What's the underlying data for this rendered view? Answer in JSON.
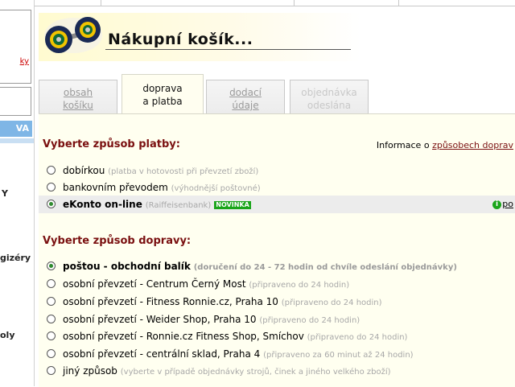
{
  "page_title": "Nákupní košík...",
  "left_nav": {
    "link_fragment": "ky",
    "va_label": "VA",
    "frag_1": "Y",
    "frag_2": "gizéry",
    "frag_3": "oly"
  },
  "tabs": [
    {
      "line1": "obsah",
      "line2": "košíku",
      "state": "link"
    },
    {
      "line1": "doprava",
      "line2": "a platba",
      "state": "active"
    },
    {
      "line1": "dodací",
      "line2": "údaje",
      "state": "link"
    },
    {
      "line1": "objednávka",
      "line2": "odeslána",
      "state": "disabled"
    }
  ],
  "payment": {
    "heading": "Vyberte způsob platby:",
    "info_prefix": "Informace o ",
    "info_link": "způsobech doprav",
    "options": [
      {
        "label": "dobírkou",
        "note": "(platba v hotovosti při převzetí zboží)",
        "selected": false
      },
      {
        "label": "bankovním převodem",
        "note": "(výhodnější poštovné)",
        "selected": false
      },
      {
        "label": "eKonto on-line",
        "note": "(Raiffeisenbank)",
        "badge": "NOVINKA",
        "selected": true,
        "info_icon": "i",
        "info_link": "po"
      }
    ]
  },
  "shipping": {
    "heading": "Vyberte způsob dopravy:",
    "options": [
      {
        "label": "poštou - obchodní balík",
        "note": "(doručení do 24 - 72 hodin od chvíle odeslání objednávky)",
        "selected": true
      },
      {
        "label": "osobní převzetí - Centrum Černý Most",
        "note": "(připraveno do 24 hodin)",
        "selected": false
      },
      {
        "label": "osobní převzetí - Fitness Ronnie.cz, Praha 10",
        "note": "(připraveno do 24 hodin)",
        "selected": false
      },
      {
        "label": "osobní převzetí - Weider Shop, Praha 10",
        "note": "(připraveno do 24 hodin)",
        "selected": false
      },
      {
        "label": "osobní převzetí - Ronnie.cz Fitness Shop, Smíchov",
        "note": "(připraveno do 24 hodin)",
        "selected": false
      },
      {
        "label": "osobní převzetí - centrální sklad, Praha 4",
        "note": "(připraveno za 60 minut až 24 hodin)",
        "selected": false
      },
      {
        "label": "jiný způsob",
        "note": "(vyberte v případě objednávky strojů, činek a jiného velkého zboží)",
        "selected": false
      }
    ]
  },
  "colors": {
    "accent": "#7a1010",
    "selected_radio": "#2f8a2f",
    "badge": "#1aa51a",
    "nav_highlight": "#7fb6e6"
  }
}
